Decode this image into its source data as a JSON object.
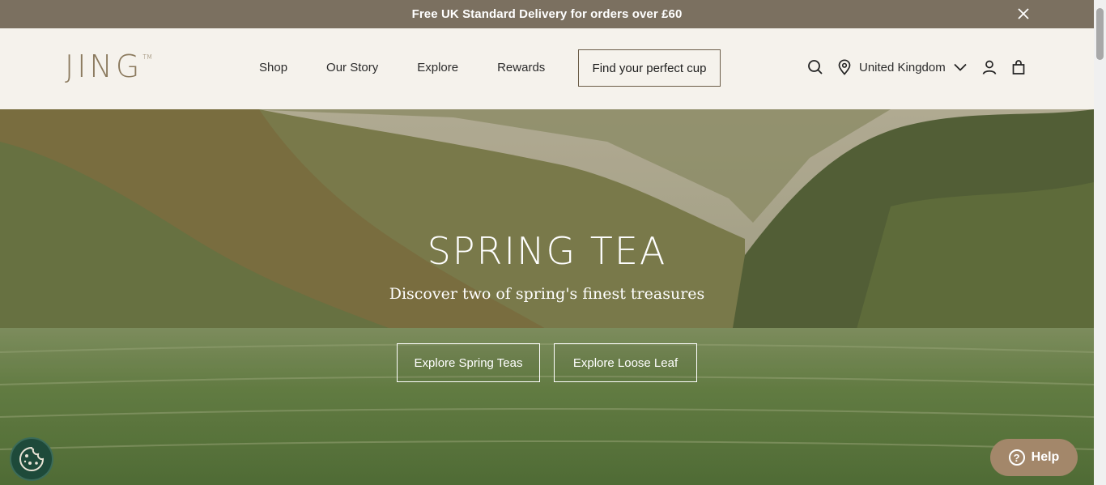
{
  "announcement": {
    "text": "Free UK Standard Delivery for orders over £60",
    "close_icon": "close-icon"
  },
  "header": {
    "logo": "JING",
    "logo_mark": "TM",
    "nav": [
      "Shop",
      "Our Story",
      "Explore",
      "Rewards"
    ],
    "cta_label": "Find your perfect cup",
    "country": "United Kingdom",
    "icons": [
      "search-icon",
      "location-pin-icon",
      "chevron-down-icon",
      "account-icon",
      "bag-icon"
    ]
  },
  "hero": {
    "title": "SPRING TEA",
    "subtitle": "Discover two of spring's finest treasures",
    "buttons": [
      "Explore Spring Teas",
      "Explore Loose Leaf"
    ]
  },
  "widgets": {
    "help_label": "Help",
    "cookie_icon": "cookie-icon"
  },
  "colors": {
    "announcement_bg": "#7b7060",
    "header_bg": "#f5f2ec",
    "logo": "#8b7a5e",
    "help_bg": "#a3876a",
    "cookie_bg": "#1e4a3a"
  }
}
